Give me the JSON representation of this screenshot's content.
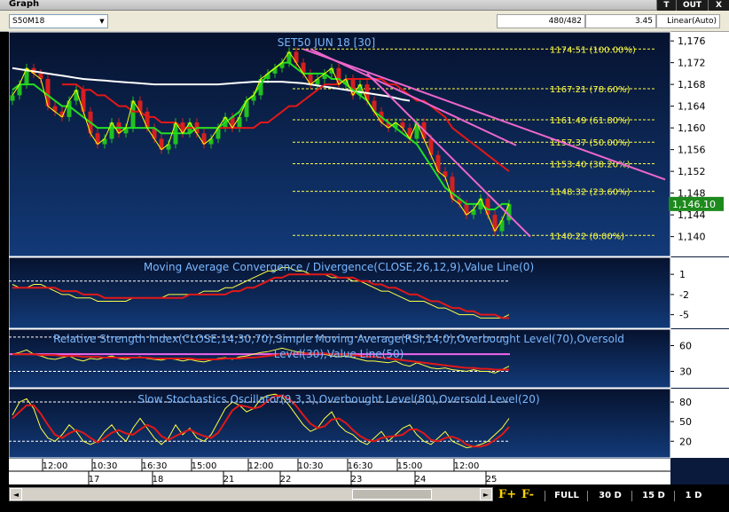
{
  "window": {
    "title": "Graph",
    "btn_t": "T",
    "btn_out": "OUT",
    "btn_x": "X"
  },
  "toolbar": {
    "symbol": "S50M18",
    "symbol_arrow": "▼",
    "count": "480/482",
    "scale_value": "3.45",
    "scale_mode": "Linear(Auto)"
  },
  "colors": {
    "background": "#0a1a3c",
    "up_candle": "#21c021",
    "down_candle": "#d42020",
    "price_line": "#ffff00",
    "ma_fast": "#22dd22",
    "ma_mid": "#e01818",
    "ma_slow": "#ffffff",
    "trend_line": "#ee66cc",
    "fib_line": "#ffff44",
    "panel_title": "#7ab8ff"
  },
  "bottom": {
    "scroll_left": "◄",
    "scroll_right": "►",
    "f_plus": "F+",
    "f_minus": "F-",
    "ranges": [
      "FULL",
      "30 D",
      "15 D",
      "1 D"
    ]
  },
  "chart_data": [
    {
      "type": "candlestick",
      "title": "SET50 JUN 18   [30]",
      "ylim": [
        1137,
        1177
      ],
      "yticks": [
        1140,
        1144,
        1148,
        1152,
        1156,
        1160,
        1164,
        1168,
        1172,
        1176
      ],
      "last_price": "1,146.10",
      "close_series": [
        1166,
        1168,
        1171,
        1170,
        1169,
        1164,
        1163,
        1162,
        1165,
        1167,
        1163,
        1159,
        1157,
        1158,
        1161,
        1159,
        1160,
        1165,
        1163,
        1160,
        1158,
        1156,
        1157,
        1161,
        1159,
        1161,
        1159,
        1157,
        1158,
        1160,
        1162,
        1160,
        1162,
        1165,
        1166,
        1169,
        1170,
        1171,
        1172,
        1174,
        1172,
        1170,
        1168,
        1169,
        1170,
        1171,
        1168,
        1169,
        1166,
        1168,
        1165,
        1163,
        1161,
        1160,
        1161,
        1160,
        1158,
        1161,
        1158,
        1155,
        1152,
        1151,
        1147,
        1146,
        1144,
        1145,
        1147,
        1144,
        1141,
        1143,
        1146
      ],
      "ma_fast": [
        1167,
        1168,
        1168,
        1168,
        1167,
        1166,
        1165,
        1164,
        1164,
        1163,
        1162,
        1161,
        1160,
        1160,
        1160,
        1160,
        1160,
        1160,
        1160,
        1160,
        1160,
        1159,
        1159,
        1159,
        1159,
        1159,
        1160,
        1160,
        1160,
        1160,
        1161,
        1162,
        1163,
        1165,
        1166,
        1168,
        1170,
        1171,
        1172,
        1172,
        1171,
        1170,
        1170,
        1170,
        1170,
        1169,
        1169,
        1168,
        1167,
        1166,
        1165,
        1163,
        1162,
        1161,
        1160,
        1159,
        1158,
        1157,
        1155,
        1153,
        1151,
        1149,
        1148,
        1147,
        1146,
        1146,
        1146,
        1145,
        1145,
        1146,
        1146
      ],
      "ma_mid": [
        1168,
        1168,
        1168,
        1167,
        1167,
        1166,
        1166,
        1165,
        1164,
        1164,
        1163,
        1163,
        1162,
        1162,
        1161,
        1161,
        1161,
        1160,
        1160,
        1160,
        1160,
        1160,
        1160,
        1160,
        1160,
        1160,
        1160,
        1160,
        1161,
        1161,
        1162,
        1163,
        1164,
        1164,
        1165,
        1166,
        1167,
        1168,
        1168,
        1168,
        1169,
        1169,
        1169,
        1169,
        1169,
        1169,
        1168,
        1168,
        1167,
        1166,
        1165,
        1165,
        1164,
        1163,
        1162,
        1160,
        1159,
        1158,
        1157,
        1156,
        1155,
        1154,
        1153,
        1152
      ],
      "ma_slow": [
        1171,
        1170.8,
        1170.6,
        1170.4,
        1170.2,
        1170,
        1169.8,
        1169.6,
        1169.4,
        1169.2,
        1169,
        1168.9,
        1168.8,
        1168.7,
        1168.6,
        1168.5,
        1168.4,
        1168.3,
        1168.2,
        1168.1,
        1168,
        1168,
        1168,
        1168,
        1168,
        1168,
        1168,
        1168,
        1168,
        1168,
        1168.1,
        1168.2,
        1168.3,
        1168.4,
        1168.5,
        1168.5,
        1168.5,
        1168.5,
        1168.5,
        1168.4,
        1168.3,
        1168.2,
        1168,
        1167.8,
        1167.6,
        1167.4,
        1167.2,
        1167,
        1166.8,
        1166.6,
        1166.4,
        1166.2,
        1166,
        1165.8,
        1165.5,
        1165.2,
        1165
      ],
      "trendlines": [
        {
          "from": [
            41,
            1174.5
          ],
          "to": [
            92,
            1150.5
          ]
        },
        {
          "from": [
            42,
            1174.5
          ],
          "to": [
            71,
            1156.8
          ]
        },
        {
          "from": [
            50,
            1170
          ],
          "to": [
            73,
            1140
          ]
        }
      ],
      "fib_levels": [
        {
          "label": "1174.51 (100.00%)",
          "value": 1174.51
        },
        {
          "label": "1167.21 (78.60%)",
          "value": 1167.21
        },
        {
          "label": "1161.49 (61.80%)",
          "value": 1161.49
        },
        {
          "label": "1157.37 (50.00%)",
          "value": 1157.37
        },
        {
          "label": "1153.40 (38.20%)",
          "value": 1153.4
        },
        {
          "label": "1148.32 (23.60%)",
          "value": 1148.32
        },
        {
          "label": "1140.22 (0.00%)",
          "value": 1140.22
        }
      ]
    },
    {
      "type": "line",
      "title": "Moving Average Convergence / Divergence(CLOSE,26,12,9),Value Line(0)",
      "ylim": [
        -6.5,
        3
      ],
      "yticks": [
        1,
        -2,
        -5
      ],
      "value_line": 0,
      "series": [
        {
          "values": [
            -0.5,
            -1,
            -1,
            -0.5,
            -0.5,
            -1,
            -1.5,
            -2,
            -2,
            -2.5,
            -2.5,
            -2.5,
            -3,
            -3,
            -3,
            -3,
            -3,
            -2.5,
            -2.5,
            -2.5,
            -2.5,
            -2.5,
            -2,
            -2,
            -2,
            -2,
            -2,
            -1.5,
            -1.5,
            -1.5,
            -1,
            -1,
            -0.5,
            0,
            0.5,
            1,
            1.5,
            1.5,
            2,
            2,
            1.5,
            1.5,
            1,
            1,
            1,
            0.5,
            0.5,
            0.5,
            0,
            0,
            -0.5,
            -1,
            -1.5,
            -1.5,
            -2,
            -2.5,
            -3,
            -3,
            -3,
            -3.5,
            -4,
            -4,
            -4.5,
            -5,
            -5,
            -5,
            -5.5,
            -5.5,
            -5.5,
            -5.5,
            -5
          ]
        },
        {
          "values": [
            -1,
            -1,
            -1,
            -1,
            -1,
            -1,
            -1,
            -1.5,
            -1.5,
            -1.5,
            -2,
            -2,
            -2,
            -2.5,
            -2.5,
            -2.5,
            -2.5,
            -2.5,
            -2.5,
            -2.5,
            -2.5,
            -2.5,
            -2.5,
            -2.5,
            -2.5,
            -2,
            -2,
            -2,
            -2,
            -2,
            -2,
            -1.5,
            -1.5,
            -1,
            -1,
            -0.5,
            0,
            0.5,
            0.5,
            1,
            1,
            1,
            1,
            1,
            1,
            1,
            0.5,
            0.5,
            0.5,
            0,
            0,
            -0.5,
            -0.5,
            -1,
            -1,
            -1.5,
            -2,
            -2,
            -2.5,
            -3,
            -3,
            -3.5,
            -4,
            -4,
            -4.5,
            -4.5,
            -5,
            -5,
            -5,
            -5.5,
            -5.5
          ]
        }
      ]
    },
    {
      "type": "line",
      "title": "Relative Strength Index(CLOSE,14,30,70),Simple Moving Average(RSI,14,0),Overbought Level(70),Oversold Level(30),Value Line(50)",
      "ylim": [
        15,
        75
      ],
      "yticks": [
        60,
        30
      ],
      "levels": [
        70,
        30,
        50
      ],
      "series": [
        {
          "values": [
            50,
            52,
            55,
            50,
            48,
            45,
            44,
            46,
            48,
            44,
            42,
            45,
            44,
            46,
            48,
            45,
            44,
            46,
            47,
            45,
            44,
            43,
            45,
            44,
            42,
            44,
            42,
            41,
            43,
            45,
            46,
            44,
            47,
            48,
            50,
            52,
            53,
            55,
            57,
            55,
            53,
            52,
            50,
            51,
            50,
            48,
            47,
            48,
            46,
            44,
            42,
            42,
            41,
            40,
            42,
            38,
            36,
            40,
            37,
            34,
            33,
            34,
            32,
            31,
            30,
            32,
            30,
            30,
            28,
            32,
            36
          ]
        },
        {
          "values": [
            50,
            50,
            50,
            50,
            49,
            49,
            49,
            48,
            48,
            48,
            47,
            47,
            47,
            46,
            46,
            46,
            46,
            46,
            46,
            46,
            45,
            45,
            45,
            45,
            45,
            45,
            44,
            44,
            44,
            44,
            45,
            45,
            45,
            46,
            46,
            47,
            48,
            49,
            50,
            50,
            51,
            51,
            51,
            51,
            51,
            50,
            50,
            50,
            49,
            48,
            47,
            47,
            46,
            45,
            44,
            43,
            42,
            41,
            40,
            39,
            38,
            37,
            36,
            35,
            34,
            34,
            33,
            33,
            32,
            32,
            32
          ]
        }
      ]
    },
    {
      "type": "line",
      "title": "Slow Stochastics Oscillator(9,3,3),Overbought Level(80),Oversold Level(20)",
      "ylim": [
        0,
        95
      ],
      "yticks": [
        80,
        50,
        20
      ],
      "levels": [
        80,
        20
      ],
      "series": [
        {
          "values": [
            60,
            80,
            85,
            70,
            40,
            25,
            20,
            30,
            45,
            35,
            20,
            15,
            20,
            35,
            45,
            30,
            20,
            40,
            55,
            40,
            25,
            15,
            25,
            45,
            30,
            40,
            25,
            20,
            30,
            50,
            70,
            80,
            75,
            65,
            70,
            85,
            90,
            92,
            88,
            75,
            60,
            45,
            35,
            40,
            55,
            65,
            45,
            35,
            30,
            20,
            15,
            25,
            35,
            20,
            30,
            40,
            45,
            30,
            20,
            15,
            25,
            35,
            20,
            15,
            10,
            12,
            15,
            20,
            30,
            40,
            55
          ]
        },
        {
          "values": [
            55,
            65,
            75,
            75,
            62,
            45,
            30,
            25,
            32,
            37,
            33,
            25,
            18,
            25,
            33,
            37,
            32,
            30,
            38,
            45,
            40,
            28,
            22,
            28,
            33,
            38,
            32,
            28,
            25,
            33,
            50,
            67,
            75,
            73,
            70,
            73,
            82,
            89,
            90,
            85,
            74,
            60,
            47,
            40,
            43,
            53,
            55,
            48,
            37,
            28,
            22,
            20,
            25,
            27,
            28,
            30,
            38,
            38,
            32,
            22,
            20,
            25,
            27,
            23,
            15,
            12,
            12,
            15,
            22,
            30,
            42
          ]
        }
      ]
    }
  ],
  "x_axis": {
    "time_labels": [
      {
        "i": 6,
        "label": "12:00"
      },
      {
        "i": 13,
        "label": "10:30"
      },
      {
        "i": 20,
        "label": "16:30"
      },
      {
        "i": 27,
        "label": "15:00"
      },
      {
        "i": 35,
        "label": "12:00"
      },
      {
        "i": 42,
        "label": "10:30"
      },
      {
        "i": 49,
        "label": "16:30"
      },
      {
        "i": 56,
        "label": "15:00"
      },
      {
        "i": 64,
        "label": "12:00"
      }
    ],
    "day_labels": [
      {
        "i": 12,
        "label": "17"
      },
      {
        "i": 21,
        "label": "18"
      },
      {
        "i": 31,
        "label": "21"
      },
      {
        "i": 39,
        "label": "22"
      },
      {
        "i": 49,
        "label": "23"
      },
      {
        "i": 58,
        "label": "24"
      },
      {
        "i": 68,
        "label": "25"
      }
    ]
  }
}
